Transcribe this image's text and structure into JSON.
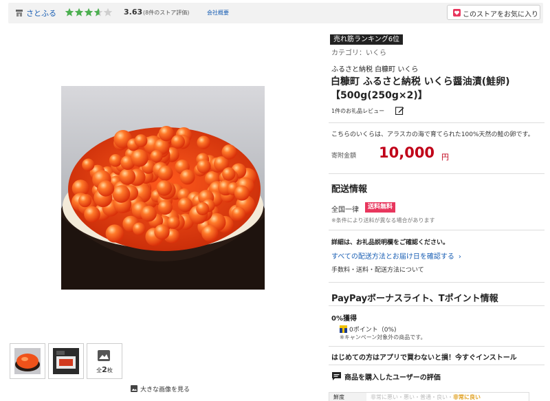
{
  "store": {
    "name": "さとふる",
    "rating": "3.63",
    "rating_value": 3.63,
    "rating_max": 5,
    "rating_count": "(8件のストア評価)",
    "company_link": "会社概要",
    "favorite_label": "このストアをお気に入り"
  },
  "gallery": {
    "image_count_prefix": "全",
    "image_count": "2",
    "image_count_suffix": "枚",
    "big_image_link": "大きな画像を見る"
  },
  "product": {
    "rank_badge": "売れ筋ランキング6位",
    "category": "カテゴリ：いくら",
    "subtitle": "ふるさと納税 白糠町 いくら",
    "title": "白糠町 ふるさと納税 いくら醤油漬(鮭卵)【500g(250g×2)】",
    "review_count": "1件のお礼品レビュー",
    "description": "こちらのいくらは、アラスカの海で育てられた100%天然の鮭の卵です。",
    "price_label": "寄附金額",
    "price": "10,000",
    "currency": "円"
  },
  "shipping": {
    "section_title": "配送情報",
    "nationwide": "全国一律",
    "free_badge": "送料無料",
    "condition_note": "※条件により送料が異なる場合があります",
    "detail_note": "詳細は、お礼品説明欄をご確認ください。",
    "methods_link": "すべての配送方法とお届け日を確認する",
    "chevron": "›",
    "fee_link": "手数料・送料・配送方法について"
  },
  "points": {
    "section_title": "PayPayボーナスライト、Tポイント情報",
    "percent": "0%獲得",
    "point_value": "0ポイント（0%)",
    "campaign_note": "※キャンペーン対象外の商品です。"
  },
  "promo": {
    "app_text": "はじめての方はアプリで買わないと損！今すぐインストール"
  },
  "reviews": {
    "title": "商品を購入したユーザーの評価",
    "row_key": "鮮度",
    "row_scale_pre": "非常に悪い・悪い・普通・良い・",
    "row_scale_hl": "非常に良い"
  },
  "colors": {
    "accent_red": "#c00018",
    "link_blue": "#1a5fb4",
    "star_green": "#4caf50",
    "free_pink": "#e8365d"
  }
}
